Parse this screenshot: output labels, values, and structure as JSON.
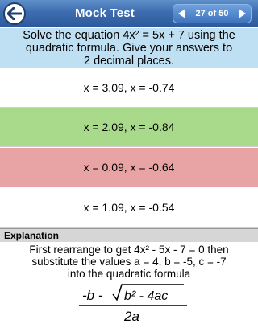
{
  "header": {
    "title": "Mock Test",
    "page_indicator": "27 of 50",
    "icons": [
      "back-arrow-icon",
      "previous-arrow-icon",
      "next-arrow-icon"
    ],
    "colors": {
      "bar": "#3d6db0"
    }
  },
  "question": {
    "line1": "Solve the equation 4x² = 5x + 7 using the",
    "line2": "quadratic formula. Give your answers to",
    "line3": "2 decimal places."
  },
  "options": [
    {
      "text": "x = 3.09, x = -0.74",
      "state": "neutral"
    },
    {
      "text": "x = 2.09, x = -0.84",
      "state": "correct",
      "color": "#a9d98a"
    },
    {
      "text": "x = 0.09, x = -0.64",
      "state": "incorrect",
      "color": "#e8a4a4"
    },
    {
      "text": "x = 1.09, x = -0.54",
      "state": "neutral"
    }
  ],
  "explanation": {
    "heading": "Explanation",
    "line1": "First rearrange to get 4x² - 5x - 7 = 0 then",
    "line2": "substitute the values a = 4, b = -5, c = -7",
    "line3": "into the quadratic formula",
    "formula": {
      "numerator_left": "-b -",
      "radicand": "b² - 4ac",
      "denominator": "2a"
    }
  }
}
